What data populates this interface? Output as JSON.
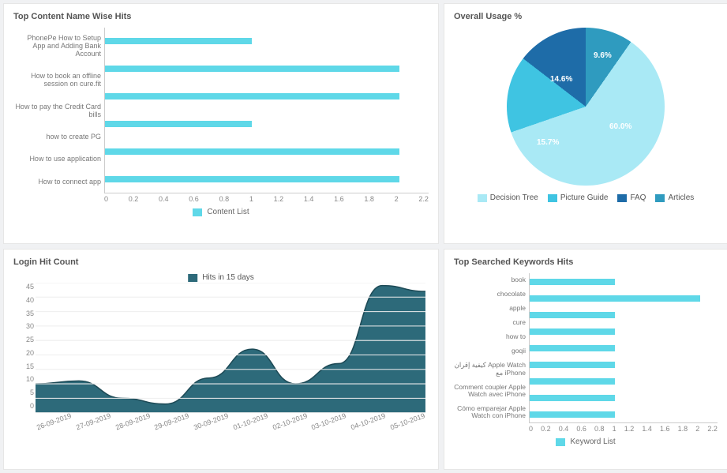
{
  "top_content": {
    "title": "Top Content Name Wise Hits",
    "legend": "Content List"
  },
  "overall_usage": {
    "title": "Overall Usage %"
  },
  "login_hit": {
    "title": "Login Hit Count",
    "legend": "Hits in 15 days"
  },
  "keywords": {
    "title": "Top Searched Keywords Hits",
    "legend": "Keyword List"
  },
  "chart_data": [
    {
      "id": "top_content",
      "type": "bar",
      "orientation": "horizontal",
      "title": "Top Content Name Wise Hits",
      "categories": [
        "PhonePe How to Setup App and Adding Bank Account",
        "How to book an offline session on cure.fit",
        "How to pay the Credit Card bills",
        "how to create PG",
        "How to use application",
        "How to connect app"
      ],
      "values": [
        1.0,
        2.0,
        2.0,
        1.0,
        2.0,
        2.0
      ],
      "xlim": [
        0,
        2.2
      ],
      "xticks": [
        0,
        0.2,
        0.4,
        0.6,
        0.8,
        1,
        1.2,
        1.4,
        1.6,
        1.8,
        2,
        2.2
      ],
      "legend": [
        "Content List"
      ],
      "color": "#5fd8e8"
    },
    {
      "id": "overall_usage",
      "type": "pie",
      "title": "Overall Usage %",
      "series": [
        {
          "name": "Decision Tree",
          "value": 60.0,
          "color": "#a9e9f5"
        },
        {
          "name": "Picture Guide",
          "value": 15.7,
          "color": "#3fc4e2"
        },
        {
          "name": "FAQ",
          "value": 14.6,
          "color": "#1e6ca8"
        },
        {
          "name": "Articles",
          "value": 9.6,
          "color": "#2f9bbf"
        }
      ],
      "labels_shown": [
        "60.0%",
        "15.7%",
        "14.6%",
        "9.6%"
      ]
    },
    {
      "id": "login_hit",
      "type": "area",
      "title": "Login Hit Count",
      "legend": [
        "Hits in 15 days"
      ],
      "x": [
        "26-09-2019",
        "27-09-2019",
        "28-09-2019",
        "29-09-2019",
        "30-09-2019",
        "01-10-2019",
        "02-10-2019",
        "03-10-2019",
        "04-10-2019",
        "05-10-2019"
      ],
      "y": [
        10,
        11,
        5,
        3,
        12,
        22,
        10,
        17,
        44,
        42
      ],
      "ylim": [
        0,
        45
      ],
      "yticks": [
        0,
        5,
        10,
        15,
        20,
        25,
        30,
        35,
        40,
        45
      ],
      "color": "#2d6a7a"
    },
    {
      "id": "keywords",
      "type": "bar",
      "orientation": "horizontal",
      "title": "Top Searched Keywords Hits",
      "categories": [
        "book",
        "chocolate",
        "apple",
        "cure",
        "how to",
        "goqii",
        "كيفية إقران Apple Watch مع iPhone",
        "Comment coupler Apple Watch avec iPhone",
        "Cómo emparejar Apple Watch con iPhone"
      ],
      "values": [
        1.0,
        2.0,
        1.0,
        1.0,
        1.0,
        1.0,
        1.0,
        1.0,
        1.0
      ],
      "xlim": [
        0,
        2.2
      ],
      "xticks": [
        0,
        0.2,
        0.4,
        0.6,
        0.8,
        1,
        1.2,
        1.4,
        1.6,
        1.8,
        2,
        2.2
      ],
      "legend": [
        "Keyword List"
      ],
      "color": "#5fd8e8"
    }
  ]
}
